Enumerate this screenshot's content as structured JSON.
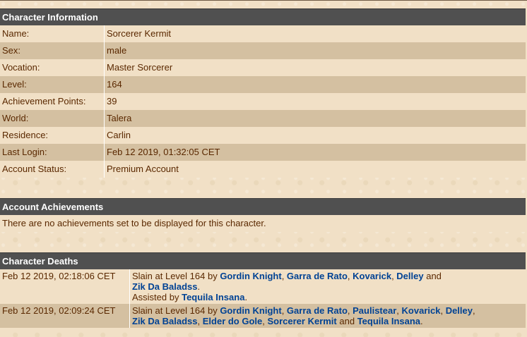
{
  "character_info": {
    "title": "Character Information",
    "rows": [
      {
        "label": "Name:",
        "value": "Sorcerer Kermit"
      },
      {
        "label": "Sex:",
        "value": "male"
      },
      {
        "label": "Vocation:",
        "value": "Master Sorcerer"
      },
      {
        "label": "Level:",
        "value": "164"
      },
      {
        "label": "Achievement Points:",
        "value": "39"
      },
      {
        "label": "World:",
        "value": "Talera"
      },
      {
        "label": "Residence:",
        "value": "Carlin"
      },
      {
        "label": "Last Login:",
        "value": "Feb 12 2019, 01:32:05 CET"
      },
      {
        "label": "Account Status:",
        "value": "Premium Account"
      }
    ]
  },
  "account_achievements": {
    "title": "Account Achievements",
    "message": "There are no achievements set to be displayed for this character."
  },
  "character_deaths": {
    "title": "Character Deaths",
    "entries": [
      {
        "date": "Feb 12 2019, 02:18:06 CET",
        "prefix": "Slain at Level 164 by",
        "killers": [
          "Gordin Knight",
          "Garra de Rato",
          "Kovarick",
          "Delley",
          "Zik Da Baladss"
        ],
        "seps": [
          ", ",
          ", ",
          ", ",
          " and "
        ],
        "end": ".",
        "assist_prefix": "Assisted by",
        "assists": [
          "Tequila Insana"
        ],
        "assist_end": "."
      },
      {
        "date": "Feb 12 2019, 02:09:24 CET",
        "prefix": "Slain at Level 164 by",
        "killers": [
          "Gordin Knight",
          "Garra de Rato",
          "Paulistear",
          "Kovarick",
          "Delley",
          "Zik Da Baladss",
          "Elder do Gole",
          "Sorcerer Kermit",
          "Tequila Insana"
        ],
        "seps": [
          ", ",
          ", ",
          ", ",
          ", ",
          ", ",
          ", ",
          ", ",
          " and "
        ],
        "end": "."
      }
    ]
  },
  "colors": {
    "header_bg": "#505050",
    "row_light": "#f1e0c6",
    "row_dark": "#d4c0a1",
    "text": "#5a2800",
    "link": "#004294"
  }
}
